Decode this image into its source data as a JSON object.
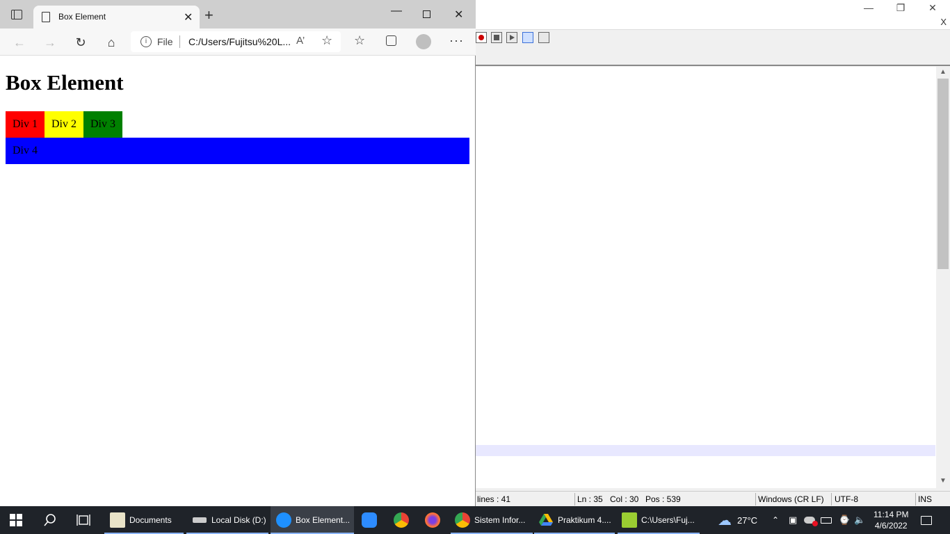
{
  "background_window": {
    "close_x": "X",
    "status": {
      "lines": "lines : 41",
      "ln": "Ln : 35",
      "col": "Col : 30",
      "pos": "Pos : 539",
      "eol": "Windows (CR LF)",
      "encoding": "UTF-8",
      "mode": "INS"
    }
  },
  "browser": {
    "tab_title": "Box Element",
    "address_scheme": "File",
    "address_url": "C:/Users/Fujitsu%20L...",
    "page": {
      "heading": "Box Element",
      "boxes": [
        {
          "label": "Div 1",
          "color": "#ff0000"
        },
        {
          "label": "Div 2",
          "color": "#ffff00"
        },
        {
          "label": "Div 3",
          "color": "#008000"
        },
        {
          "label": "Div 4",
          "color": "#0000ff"
        }
      ]
    }
  },
  "taskbar": {
    "items": [
      {
        "label": "Documents",
        "icon": "file-explorer-icon"
      },
      {
        "label": "Local Disk (D:)",
        "icon": "drive-icon"
      },
      {
        "label": "Box Element...",
        "icon": "edge-icon"
      },
      {
        "label": "Sistem Infor...",
        "icon": "chrome-icon"
      },
      {
        "label": "Praktikum 4....",
        "icon": "google-drive-icon"
      },
      {
        "label": "C:\\Users\\Fuj...",
        "icon": "notepadpp-icon"
      }
    ],
    "weather": "27°C",
    "time": "11:14 PM",
    "date": "4/6/2022"
  }
}
